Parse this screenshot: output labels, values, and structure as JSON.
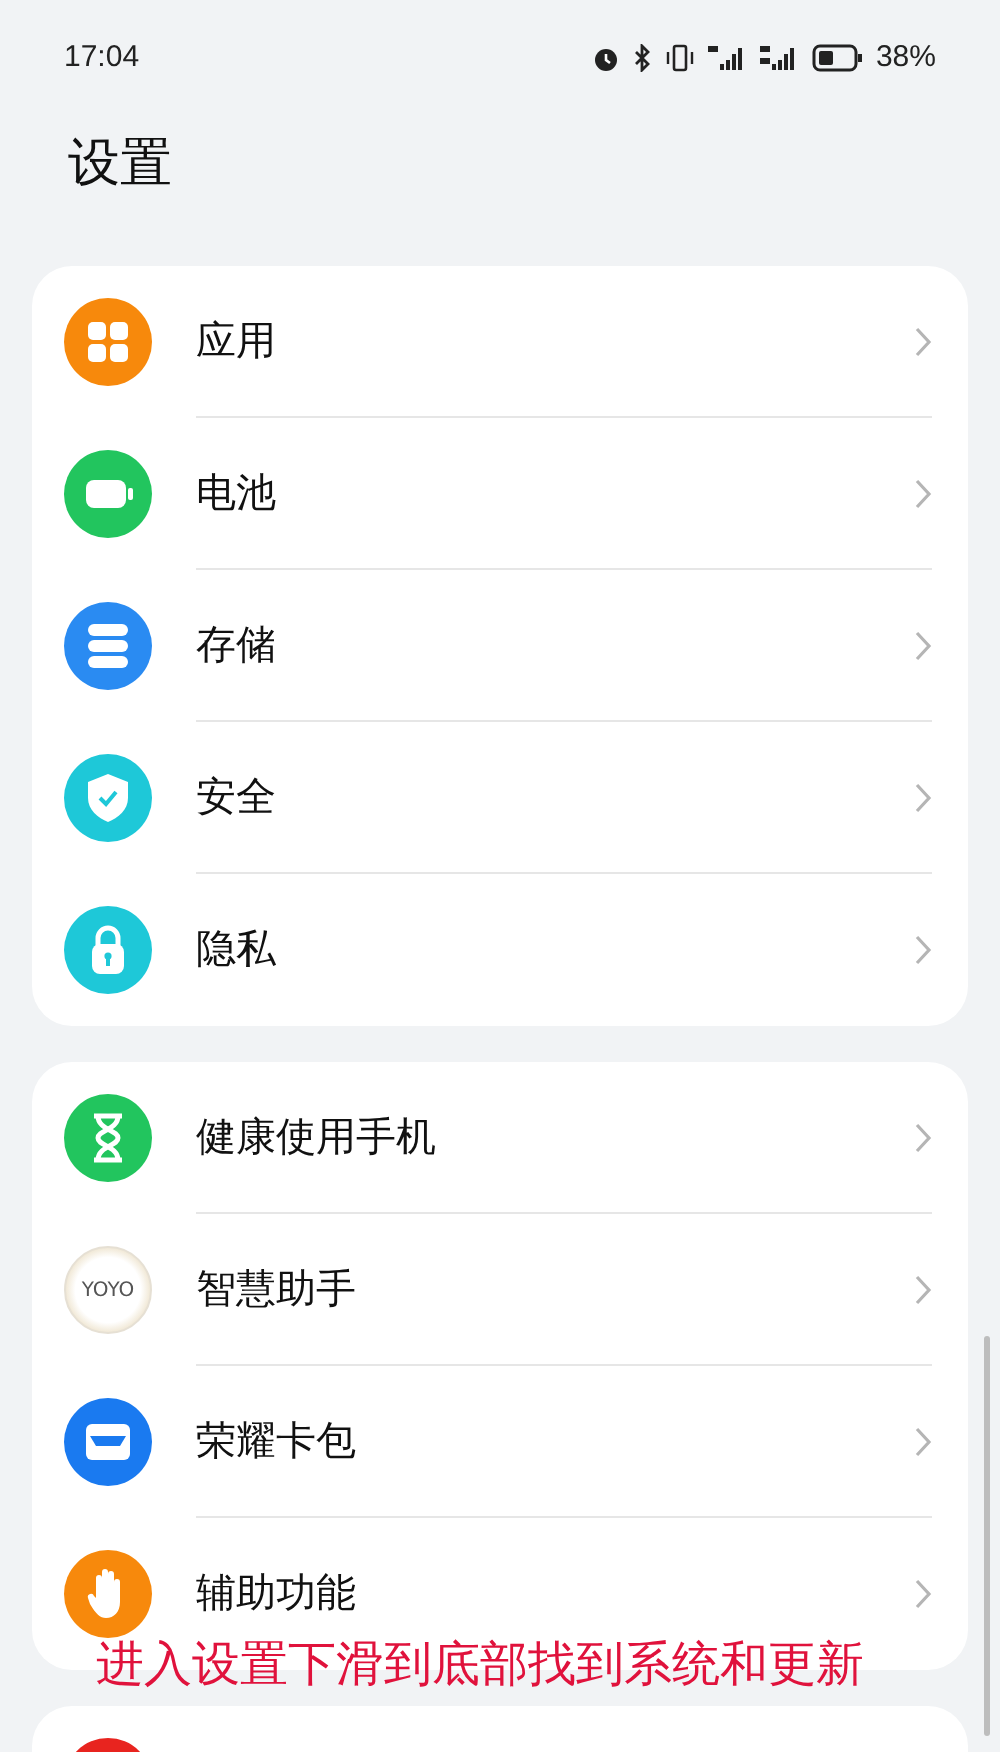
{
  "status_bar": {
    "time": "17:04",
    "battery": "38%"
  },
  "title": "设置",
  "groups": [
    {
      "items": [
        {
          "label": "应用",
          "kind": "apps"
        },
        {
          "label": "电池",
          "kind": "battery"
        },
        {
          "label": "存储",
          "kind": "storage"
        },
        {
          "label": "安全",
          "kind": "security"
        },
        {
          "label": "隐私",
          "kind": "privacy"
        }
      ]
    },
    {
      "items": [
        {
          "label": "健康使用手机",
          "kind": "hourglass"
        },
        {
          "label": "智慧助手",
          "kind": "yoyo",
          "icon_text": "YOYO"
        },
        {
          "label": "荣耀卡包",
          "kind": "wallet"
        },
        {
          "label": "辅助功能",
          "kind": "hand"
        }
      ]
    },
    {
      "items": [
        {
          "kind": "red"
        }
      ]
    }
  ],
  "annotation": "进入设置下滑到底部找到系统和更新"
}
